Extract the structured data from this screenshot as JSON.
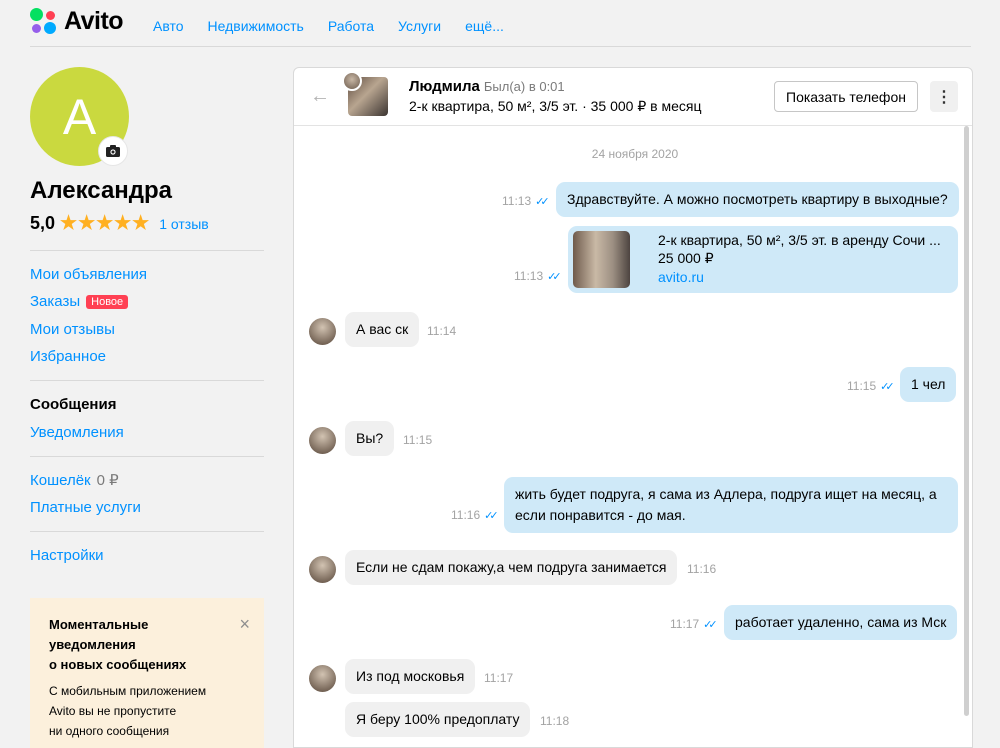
{
  "header": {
    "logo": "Avito",
    "nav": [
      "Авто",
      "Недвижимость",
      "Работа",
      "Услуги",
      "ещё..."
    ]
  },
  "profile": {
    "avatar_letter": "А",
    "name": "Александра",
    "rating": "5,0",
    "stars": "★★★★★",
    "reviews": "1 отзыв"
  },
  "menu": {
    "my_ads": "Мои объявления",
    "orders": "Заказы",
    "orders_badge": "Новое",
    "my_reviews": "Мои отзывы",
    "favorites": "Избранное",
    "messages": "Сообщения",
    "notifications": "Уведомления",
    "wallet": "Кошелёк",
    "wallet_value": "0 ₽",
    "paid_services": "Платные услуги",
    "settings": "Настройки"
  },
  "promo": {
    "title_1": "Моментальные",
    "title_2": "уведомления",
    "title_3": "о новых сообщениях",
    "text_1": "С мобильным приложением",
    "text_2": "Avito вы не пропустите",
    "text_3": "ни одного сообщения",
    "close_icon": "×"
  },
  "chat": {
    "name": "Людмила",
    "last_seen": "Был(а) в 0:01",
    "item": "2-к квартира, 50 м², 3/5 эт. · 35 000 ₽ в месяц",
    "phone_button": "Показать телефон",
    "more_icon": "⋮",
    "date": "24 ноября 2020",
    "card": {
      "title": "2-к квартира, 50 м², 3/5 эт. в аренду Сочи ...",
      "price": "25 000 ₽",
      "link": "avito.ru",
      "time": "11:13"
    },
    "messages": [
      {
        "text": "Здравствуйте. А можно посмотреть квартиру в выходные?",
        "time": "11:13"
      },
      {
        "text": "А вас ск",
        "time": "11:14"
      },
      {
        "text": "1 чел",
        "time": "11:15"
      },
      {
        "text": "Вы?",
        "time": "11:15"
      },
      {
        "text_1": "жить будет подруга, я сама из Адлера, подруга ищет на месяц, а",
        "text_2": "если понравится - до мая.",
        "time": "11:16"
      },
      {
        "text": "Если не сдам покажу,а чем подруга занимается",
        "time": "11:16"
      },
      {
        "text": "работает удаленно, сама из Мск",
        "time": "11:17"
      },
      {
        "text": "Из под московья",
        "time": "11:17"
      },
      {
        "text": "Я беру 100% предоплату",
        "time": "11:18"
      }
    ]
  }
}
